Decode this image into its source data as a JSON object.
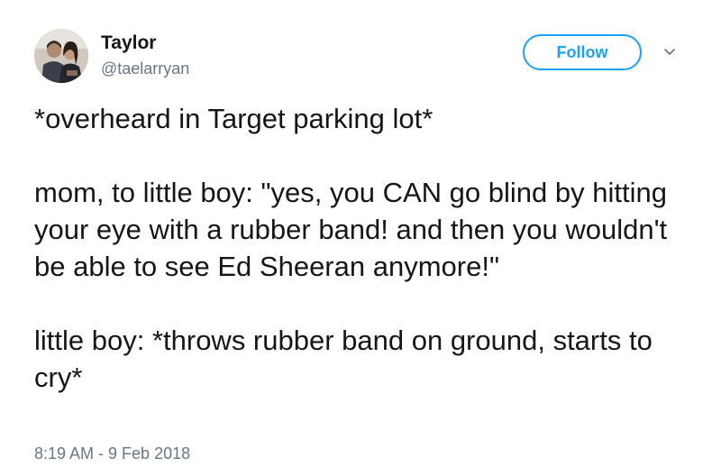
{
  "author": {
    "display_name": "Taylor",
    "handle": "@taelarryan",
    "avatar_icon": "profile-photo"
  },
  "actions": {
    "follow_label": "Follow",
    "more_icon": "chevron-down-icon"
  },
  "tweet": {
    "text": "*overheard in Target parking lot*\n\nmom, to little boy: \"yes, you CAN go blind by hitting your eye with a rubber band! and then you wouldn't be able to see Ed Sheeran anymore!\"\n\nlittle boy: *throws rubber band on ground, starts to cry*",
    "timestamp": "8:19 AM - 9 Feb 2018"
  },
  "colors": {
    "accent": "#1da1f2",
    "text_primary": "#14171a",
    "text_secondary": "#657786"
  }
}
